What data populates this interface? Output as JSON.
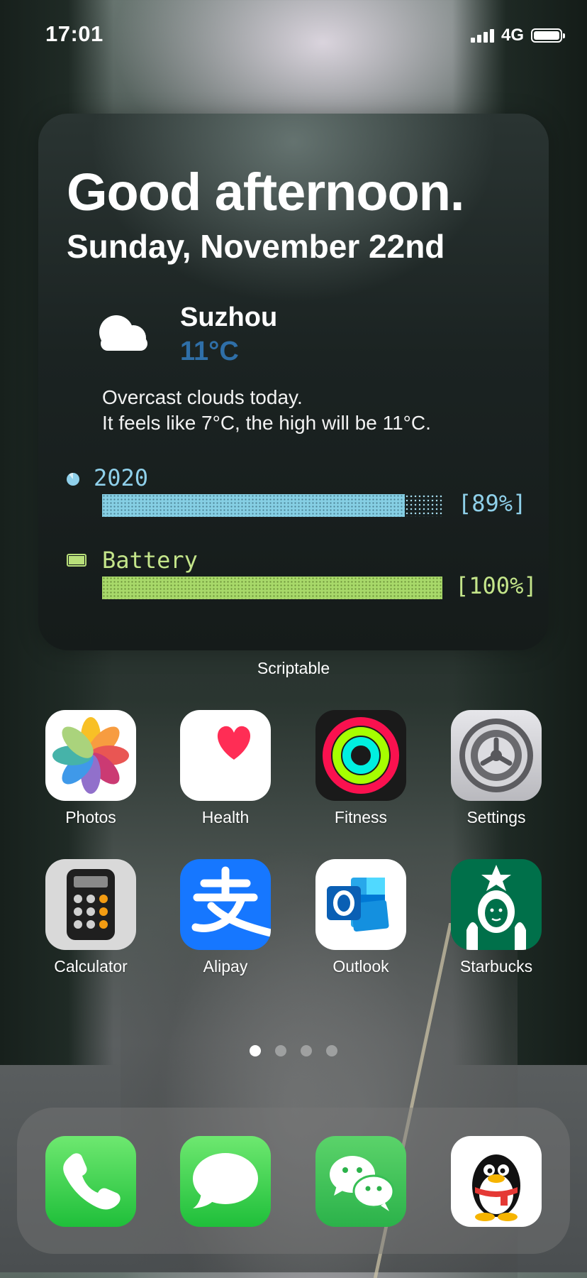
{
  "status_bar": {
    "time": "17:01",
    "network": "4G",
    "battery_level": 1.0
  },
  "widget": {
    "greeting": "Good afternoon.",
    "date": "Sunday, November 22nd",
    "weather": {
      "icon": "cloud-icon",
      "city": "Suzhou",
      "temperature": "11°C",
      "line1": "Overcast clouds today.",
      "line2": "It feels like 7°C, the high will be 11°C."
    },
    "year_progress": {
      "label": "2020",
      "percent_text": "[89%]",
      "value": 0.89,
      "color": "#8fd0ea"
    },
    "battery_progress": {
      "label": "Battery",
      "percent_text": "[100%]",
      "value": 1.0,
      "color": "#c4e58a"
    },
    "caption": "Scriptable"
  },
  "apps": [
    {
      "label": "Photos",
      "icon": "photos-icon"
    },
    {
      "label": "Health",
      "icon": "health-heart-icon"
    },
    {
      "label": "Fitness",
      "icon": "fitness-rings-icon"
    },
    {
      "label": "Settings",
      "icon": "settings-gear-icon"
    },
    {
      "label": "Calculator",
      "icon": "calculator-icon"
    },
    {
      "label": "Alipay",
      "icon": "alipay-icon"
    },
    {
      "label": "Outlook",
      "icon": "outlook-icon"
    },
    {
      "label": "Starbucks",
      "icon": "starbucks-icon"
    }
  ],
  "page_indicator": {
    "count": 4,
    "active": 0
  },
  "dock": [
    {
      "icon": "phone-icon"
    },
    {
      "icon": "messages-icon"
    },
    {
      "icon": "wechat-icon"
    },
    {
      "icon": "qq-penguin-icon"
    }
  ]
}
